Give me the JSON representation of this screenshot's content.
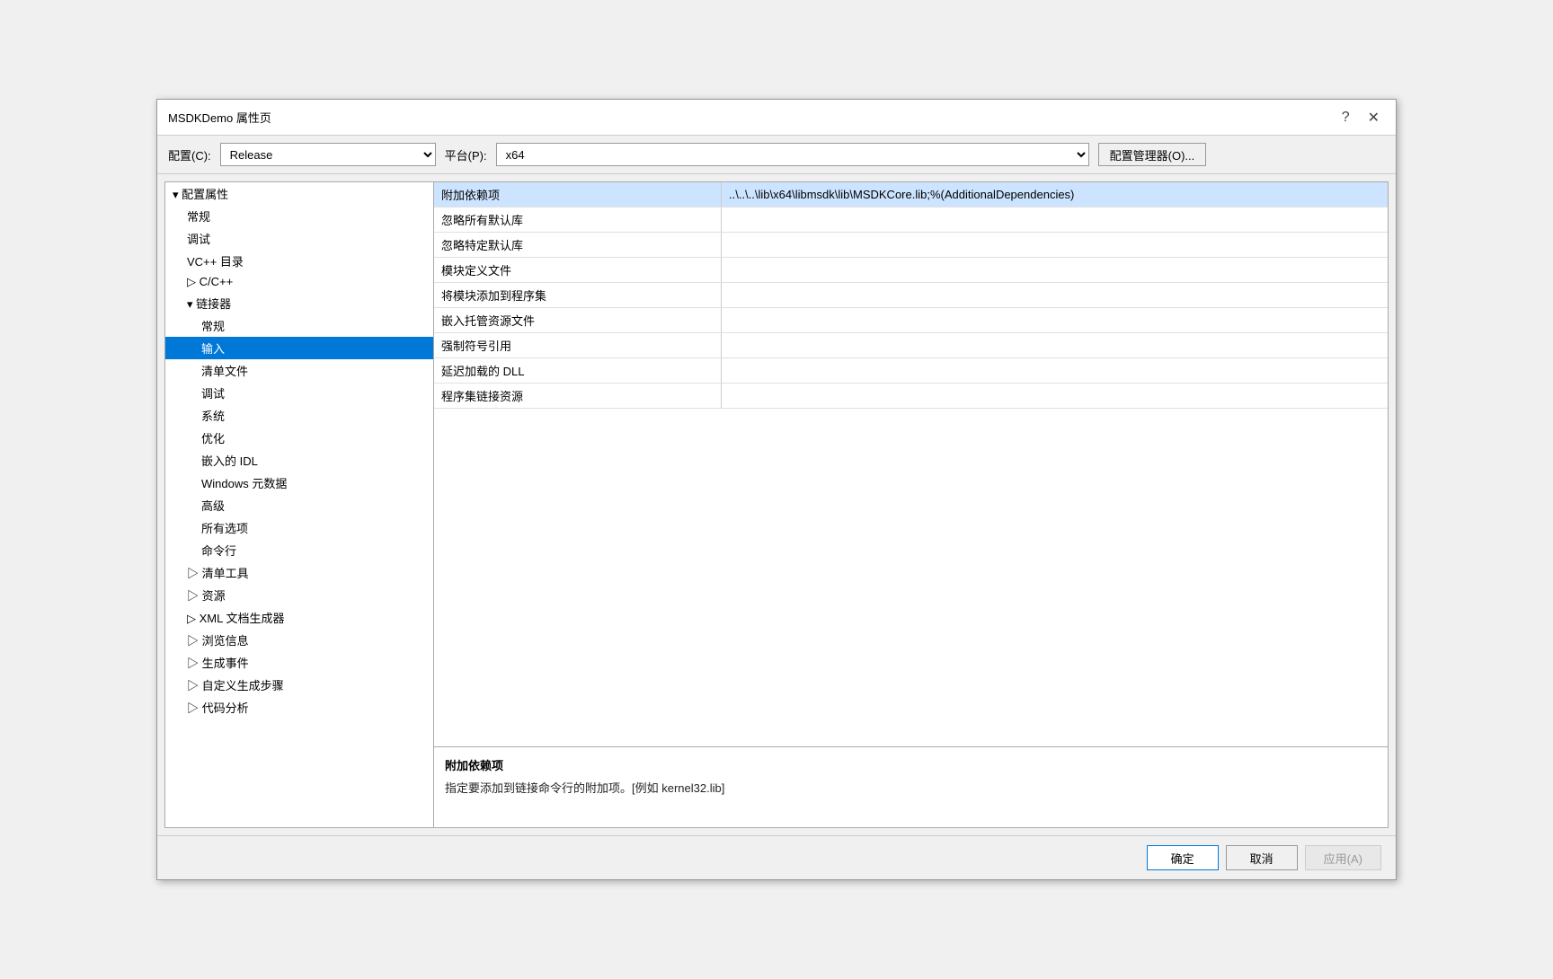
{
  "dialog": {
    "title": "MSDKDemo 属性页",
    "help_button": "?",
    "close_button": "✕"
  },
  "toolbar": {
    "config_label": "配置(C):",
    "config_value": "Release",
    "platform_label": "平台(P):",
    "platform_value": "x64",
    "config_manager_label": "配置管理器(O)..."
  },
  "tree": {
    "items": [
      {
        "id": "peizhi",
        "label": "▾ 配置属性",
        "level": 0,
        "selected": false
      },
      {
        "id": "changgui",
        "label": "常规",
        "level": 1,
        "selected": false
      },
      {
        "id": "tiaoshi1",
        "label": "调试",
        "level": 1,
        "selected": false
      },
      {
        "id": "vcpp",
        "label": "VC++ 目录",
        "level": 1,
        "selected": false
      },
      {
        "id": "cpp",
        "label": "▷ C/C++",
        "level": 1,
        "selected": false
      },
      {
        "id": "lianjieqi",
        "label": "▾ 链接器",
        "level": 1,
        "selected": false
      },
      {
        "id": "lj_changgui",
        "label": "常规",
        "level": 2,
        "selected": false
      },
      {
        "id": "lj_shuru",
        "label": "输入",
        "level": 2,
        "selected": true
      },
      {
        "id": "lj_qingdan",
        "label": "清单文件",
        "level": 2,
        "selected": false
      },
      {
        "id": "lj_tiaoshi",
        "label": "调试",
        "level": 2,
        "selected": false
      },
      {
        "id": "lj_xitong",
        "label": "系统",
        "level": 2,
        "selected": false
      },
      {
        "id": "lj_youhua",
        "label": "优化",
        "level": 2,
        "selected": false
      },
      {
        "id": "lj_qianru",
        "label": "嵌入的 IDL",
        "level": 2,
        "selected": false
      },
      {
        "id": "lj_windows",
        "label": "Windows 元数据",
        "level": 2,
        "selected": false
      },
      {
        "id": "lj_gaoji",
        "label": "高级",
        "level": 2,
        "selected": false
      },
      {
        "id": "lj_suoyou",
        "label": "所有选项",
        "level": 2,
        "selected": false
      },
      {
        "id": "lj_mingling",
        "label": "命令行",
        "level": 2,
        "selected": false
      },
      {
        "id": "qingdan_gj",
        "label": "▷ 清单工具",
        "level": 1,
        "selected": false
      },
      {
        "id": "ziyuan",
        "label": "▷ 资源",
        "level": 1,
        "selected": false
      },
      {
        "id": "xml_wj",
        "label": "▷ XML 文档生成器",
        "level": 1,
        "selected": false
      },
      {
        "id": "liulan",
        "label": "▷ 浏览信息",
        "level": 1,
        "selected": false
      },
      {
        "id": "shengcheng",
        "label": "▷ 生成事件",
        "level": 1,
        "selected": false
      },
      {
        "id": "zidingyi",
        "label": "▷ 自定义生成步骤",
        "level": 1,
        "selected": false
      },
      {
        "id": "daima",
        "label": "▷ 代码分析",
        "level": 1,
        "selected": false
      }
    ]
  },
  "props": {
    "rows": [
      {
        "id": "fujiayilaiqx",
        "key": "附加依赖项",
        "value": "..\\..\\..\\lib\\x64\\libmsdk\\lib\\MSDKCore.lib;%(AdditionalDependencies)",
        "selected": true
      },
      {
        "id": "huluesuoyou",
        "key": "忽略所有默认库",
        "value": "",
        "selected": false
      },
      {
        "id": "huluezhiding",
        "key": "忽略特定默认库",
        "value": "",
        "selected": false
      },
      {
        "id": "mokuaidingyi",
        "key": "模块定义文件",
        "value": "",
        "selected": false
      },
      {
        "id": "jiatijia",
        "key": "将模块添加到程序集",
        "value": "",
        "selected": false
      },
      {
        "id": "qianrutuguan",
        "key": "嵌入托管资源文件",
        "value": "",
        "selected": false
      },
      {
        "id": "qiangzhifuhao",
        "key": "强制符号引用",
        "value": "",
        "selected": false
      },
      {
        "id": "yanchijiazai",
        "key": "延迟加载的 DLL",
        "value": "",
        "selected": false
      },
      {
        "id": "chengxujilianjie",
        "key": "程序集链接资源",
        "value": "",
        "selected": false
      }
    ]
  },
  "description": {
    "title": "附加依赖项",
    "text": "指定要添加到链接命令行的附加项。[例如 kernel32.lib]"
  },
  "footer": {
    "confirm_label": "确定",
    "cancel_label": "取消",
    "apply_label": "应用(A)"
  }
}
